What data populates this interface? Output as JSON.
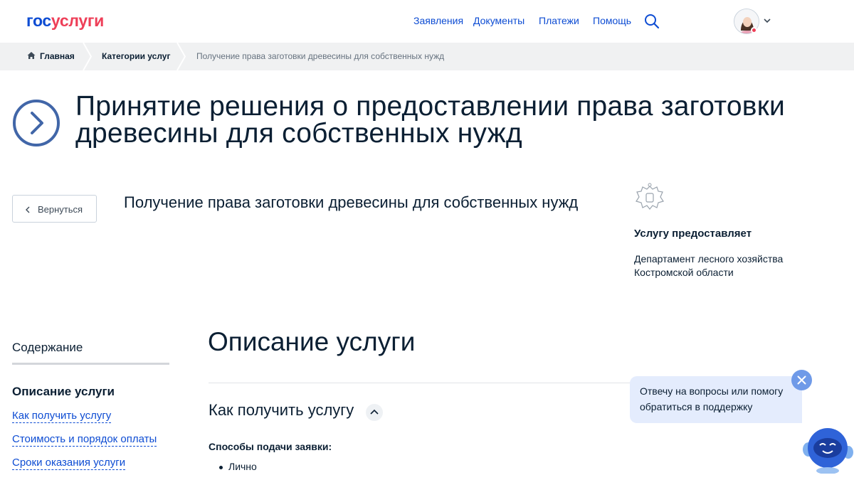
{
  "header": {
    "logo_part1": "гос",
    "logo_part2": "услуги",
    "nav": [
      "Заявления",
      "Документы",
      "Платежи",
      "Помощь"
    ]
  },
  "breadcrumbs": [
    "Главная",
    "Категории услуг",
    "Получение права заготовки древесины для собственных нужд"
  ],
  "title": "Принятие решения о предоставлении права заготовки древесины для собственных нужд",
  "back_label": "Вернуться",
  "subtitle": "Получение права заготовки древесины для собственных нужд",
  "provider": {
    "heading": "Услугу предоставляет",
    "name": "Департамент лесного хозяйства Костромской области"
  },
  "toc": {
    "title": "Содержание",
    "active": "Описание услуги",
    "links": [
      "Как получить услугу",
      "Стоимость и порядок оплаты",
      "Сроки оказания услуги"
    ]
  },
  "main": {
    "section_title": "Описание услуги",
    "how_title": "Как получить услугу",
    "methods_heading": "Способы подачи заявки:",
    "methods": [
      "Лично"
    ]
  },
  "chat": {
    "message": "Отвечу на вопросы или помогу обратиться в поддержку"
  },
  "colors": {
    "brand_blue": "#0d4cd3",
    "brand_red": "#ee3f58",
    "text": "#0b1f33",
    "breadcrumb_bg": "#f0f1f2",
    "chat_bubble": "#e4ecfd"
  },
  "icons": [
    "home-icon",
    "search-icon",
    "chevron-right-circle-icon",
    "chevron-left-icon",
    "coat-of-arms-icon",
    "chevron-up-icon",
    "close-icon",
    "chat-robot-icon",
    "chevron-down-icon"
  ]
}
